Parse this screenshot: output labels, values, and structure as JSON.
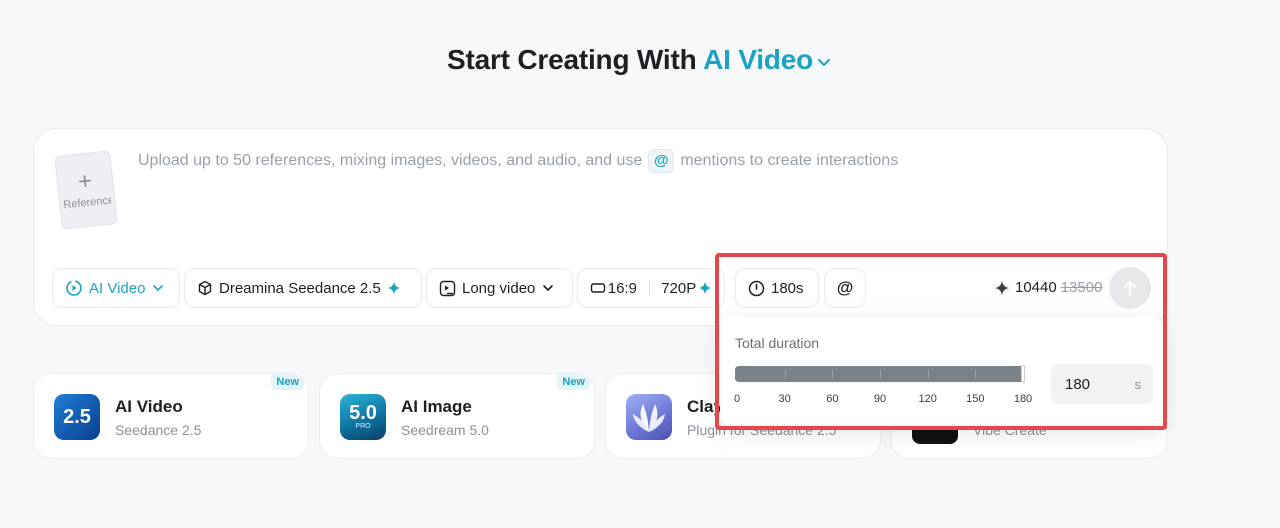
{
  "heading": {
    "prefix": "Start Creating With",
    "mode": "AI Video"
  },
  "composer": {
    "reference_label": "Reference",
    "prompt_before": "Upload up to 50 references, mixing images, videos, and audio, and use",
    "prompt_at": "@",
    "prompt_after": "mentions to create interactions"
  },
  "toolbar": {
    "mode_label": "AI Video",
    "model_label": "Dreamina Seedance 2.5",
    "length_label": "Long video",
    "ratio_label": "16:9",
    "resolution_label": "720P",
    "duration_label": "180s",
    "mention_label": "@",
    "credits_value": "10440",
    "credits_original": "13500"
  },
  "duration_popover": {
    "title": "Total duration",
    "ticks": [
      "0",
      "30",
      "60",
      "90",
      "120",
      "150",
      "180"
    ],
    "min": 0,
    "max": 180,
    "value": 180,
    "input_value": "180",
    "unit": "s"
  },
  "cards": [
    {
      "name": "AI Video",
      "sub": "Seedance 2.5",
      "badge": "New",
      "icon_text": "2.5"
    },
    {
      "name": "AI Image",
      "sub": "Seedream 5.0",
      "badge": "New",
      "icon_text": "5.0",
      "icon_sub": "PRO"
    },
    {
      "name": "Clay",
      "sub": "Plugin for Seedance 2.5"
    },
    {
      "name": "",
      "sub": "Vibe Create"
    }
  ],
  "colors": {
    "accent": "#1aa3c4",
    "highlight": "#e4474c",
    "slider_fill": "#7b838a"
  }
}
